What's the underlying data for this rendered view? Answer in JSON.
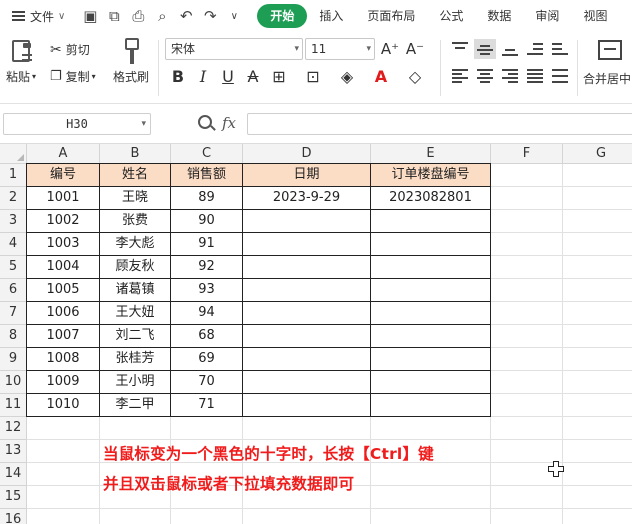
{
  "menubar": {
    "file_label": "文件",
    "tabs": [
      {
        "label": "开始",
        "active": true
      },
      {
        "label": "插入",
        "active": false
      },
      {
        "label": "页面布局",
        "active": false
      },
      {
        "label": "公式",
        "active": false
      },
      {
        "label": "数据",
        "active": false
      },
      {
        "label": "审阅",
        "active": false
      },
      {
        "label": "视图",
        "active": false
      }
    ],
    "accent_color": "#1e9e55"
  },
  "ribbon": {
    "paste_label": "粘贴",
    "cut_label": "剪切",
    "copy_label": "复制",
    "format_painter_label": "格式刷",
    "font_name": "宋体",
    "font_size": "11",
    "merge_label": "合并居中"
  },
  "formula_bar": {
    "name_box": "H30",
    "fx_label": "fx",
    "formula": ""
  },
  "sheet": {
    "columns": [
      "A",
      "B",
      "C",
      "D",
      "E",
      "F",
      "G"
    ],
    "rows": [
      "1",
      "2",
      "3",
      "4",
      "5",
      "6",
      "7",
      "8",
      "9",
      "10",
      "11",
      "12",
      "13",
      "14",
      "15",
      "16"
    ],
    "header": [
      "编号",
      "姓名",
      "销售额",
      "日期",
      "订单楼盘编号"
    ],
    "data": [
      [
        "1001",
        "王晓",
        "89",
        "2023-9-29",
        "2023082801"
      ],
      [
        "1002",
        "张费",
        "90",
        "",
        ""
      ],
      [
        "1003",
        "李大彪",
        "91",
        "",
        ""
      ],
      [
        "1004",
        "顾友秋",
        "92",
        "",
        ""
      ],
      [
        "1005",
        "诸葛镇",
        "93",
        "",
        ""
      ],
      [
        "1006",
        "王大妞",
        "94",
        "",
        ""
      ],
      [
        "1007",
        "刘二飞",
        "68",
        "",
        ""
      ],
      [
        "1008",
        "张桂芳",
        "69",
        "",
        ""
      ],
      [
        "1009",
        "王小明",
        "70",
        "",
        ""
      ],
      [
        "1010",
        "李二甲",
        "71",
        "",
        ""
      ]
    ],
    "header_fill": "#fbdcc5"
  },
  "annotation": {
    "line1": "当鼠标变为一个黑色的十字时，长按【Ctrl】键",
    "line2": "并且双击鼠标或者下拉填充数据即可",
    "color": "#f01c1c"
  }
}
